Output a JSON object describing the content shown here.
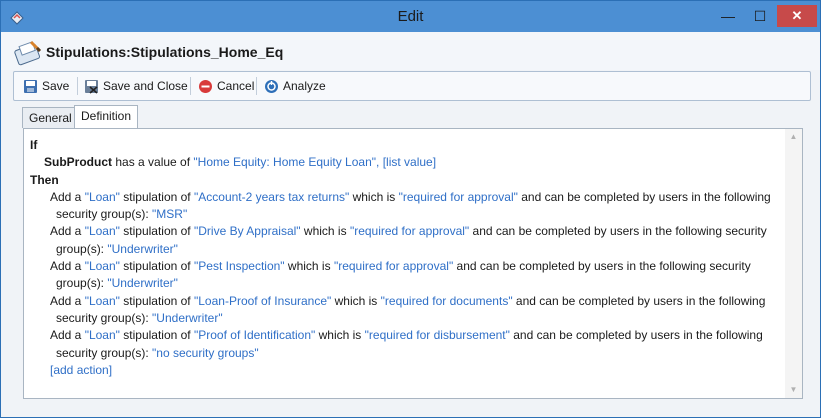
{
  "window": {
    "title": "Edit",
    "controls": {
      "minimize": "—",
      "maximize": "☐",
      "close": "✕"
    }
  },
  "header": {
    "title": "Stipulations:Stipulations_Home_Eq"
  },
  "toolbar": {
    "save": "Save",
    "save_close": "Save and Close",
    "cancel": "Cancel",
    "analyze": "Analyze"
  },
  "tabs": [
    {
      "label": "General",
      "active": false
    },
    {
      "label": "Definition",
      "active": true
    }
  ],
  "rule": {
    "if": "If",
    "condition": {
      "field": "SubProduct",
      "op": "has a value of",
      "value": "\"Home Equity: Home Equity Loan\",",
      "list": "[list value]"
    },
    "then": "Then",
    "actions": [
      {
        "prefix": "Add a",
        "type": "\"Loan\"",
        "mid": "stipulation of",
        "name": "\"Account-2 years tax returns\"",
        "which": "which is",
        "req": "\"required for approval\"",
        "tail1": "and can be completed by users in the following",
        "tail2": "security group(s):",
        "group": "\"MSR\""
      },
      {
        "prefix": "Add a",
        "type": "\"Loan\"",
        "mid": "stipulation of",
        "name": "\"Drive By Appraisal\"",
        "which": "which is",
        "req": "\"required for approval\"",
        "tail1": "and can be completed by users in the following security",
        "tail2": "group(s):",
        "group": "\"Underwriter\""
      },
      {
        "prefix": "Add a",
        "type": "\"Loan\"",
        "mid": "stipulation of",
        "name": "\"Pest Inspection\"",
        "which": "which is",
        "req": "\"required for approval\"",
        "tail1": "and can be completed by users in the following security",
        "tail2": "group(s):",
        "group": "\"Underwriter\""
      },
      {
        "prefix": "Add a",
        "type": "\"Loan\"",
        "mid": "stipulation of",
        "name": "\"Loan-Proof of Insurance\"",
        "which": "which is",
        "req": "\"required for documents\"",
        "tail1": "and can be completed by users in the following",
        "tail2": "security group(s):",
        "group": "\"Underwriter\""
      },
      {
        "prefix": "Add a",
        "type": "\"Loan\"",
        "mid": "stipulation of",
        "name": "\"Proof of Identification\"",
        "which": "which is",
        "req": "\"required for disbursement\"",
        "tail1": "and can be completed by users in the following",
        "tail2": "security group(s):",
        "group": "\"no security groups\""
      }
    ],
    "add_action": "[add action]"
  },
  "colors": {
    "titlebar": "#4c8fd3",
    "link": "#2f6fc7",
    "close_button": "#c74a4a"
  },
  "icons": [
    "app-icon",
    "stipulation-icon",
    "save-icon",
    "save-close-icon",
    "cancel-icon",
    "analyze-icon"
  ]
}
